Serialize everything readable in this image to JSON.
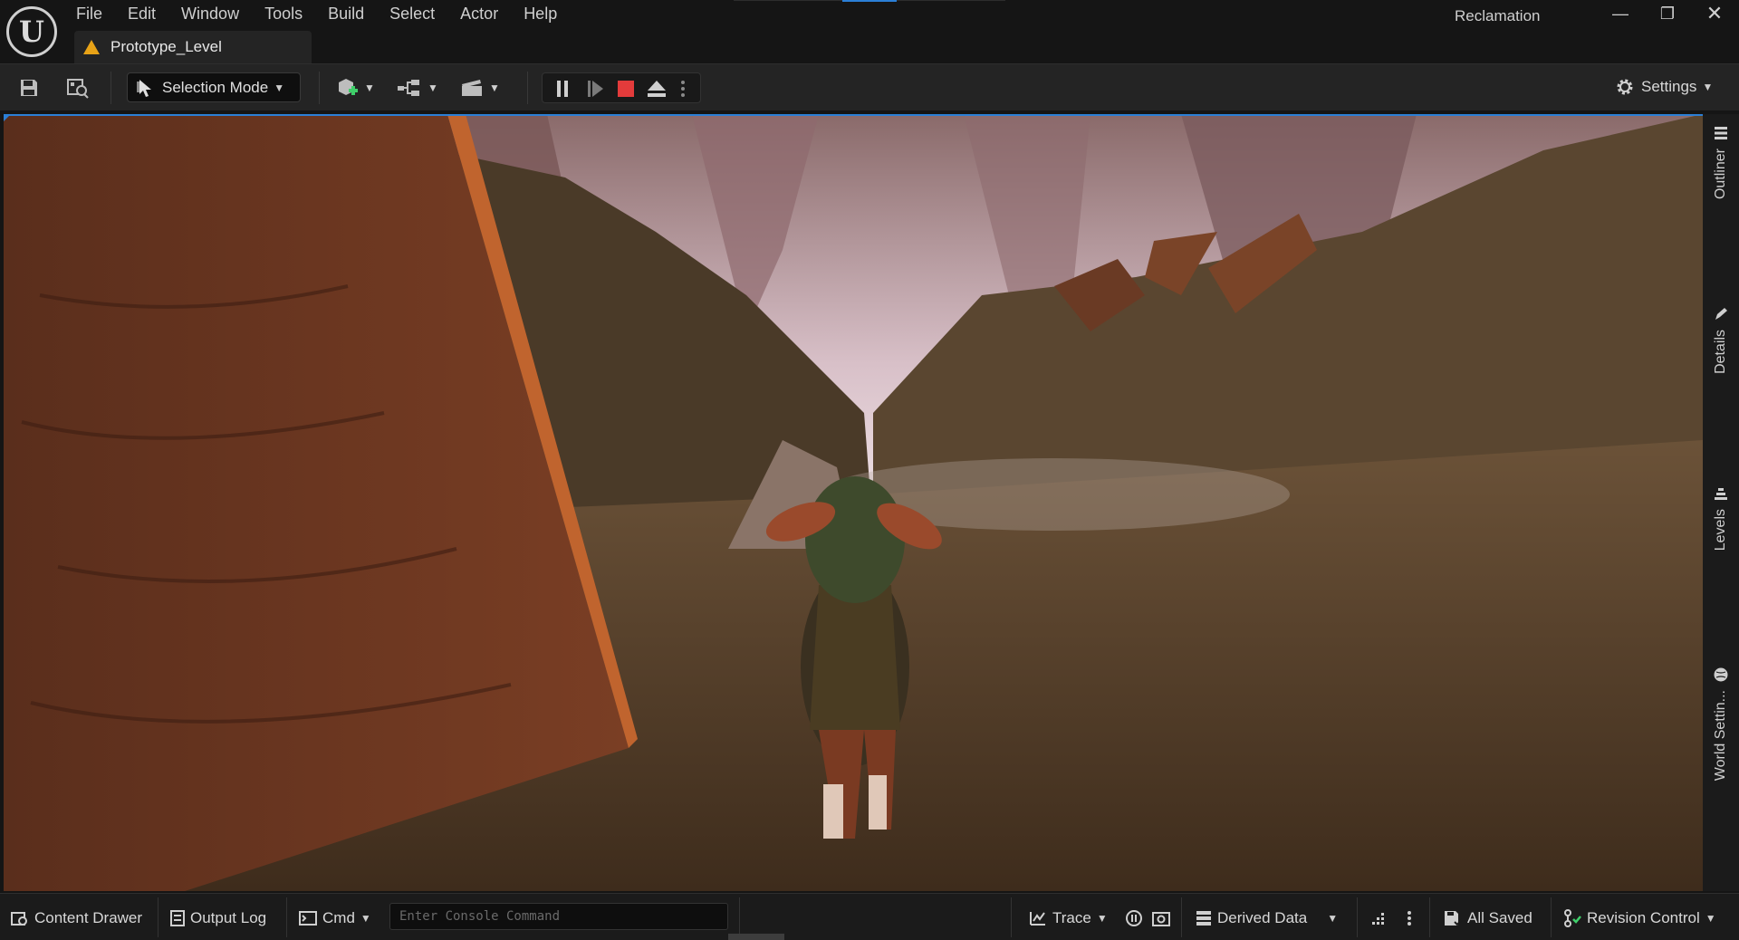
{
  "app": {
    "title": "Reclamation",
    "logo_letter": "U",
    "level_tab": "Prototype_Level"
  },
  "menu": [
    "File",
    "Edit",
    "Window",
    "Tools",
    "Build",
    "Select",
    "Actor",
    "Help"
  ],
  "window_controls": {
    "minimize": "—",
    "maximize": "❐",
    "close": "✕"
  },
  "toolbar": {
    "selection_mode": "Selection Mode",
    "settings": "Settings"
  },
  "side_panel": {
    "tabs": [
      "Outliner",
      "Details",
      "Levels",
      "World Settin..."
    ]
  },
  "status_bar": {
    "content_drawer": "Content Drawer",
    "output_log": "Output Log",
    "cmd": "Cmd",
    "console_placeholder": "Enter Console Command",
    "trace": "Trace",
    "derived_data": "Derived Data",
    "all_saved": "All Saved",
    "revision_control": "Revision Control"
  },
  "colors": {
    "accent": "#2b7fd6",
    "stop": "#e33b3b",
    "warning": "#e8a317",
    "revision_ok": "#3fcf6a"
  },
  "icons": [
    "save-icon",
    "browse-icon",
    "cursor-icon",
    "add-actor-icon",
    "blueprint-icon",
    "cinematics-icon",
    "pause-icon",
    "step-icon",
    "stop-icon",
    "eject-icon",
    "gear-icon"
  ]
}
